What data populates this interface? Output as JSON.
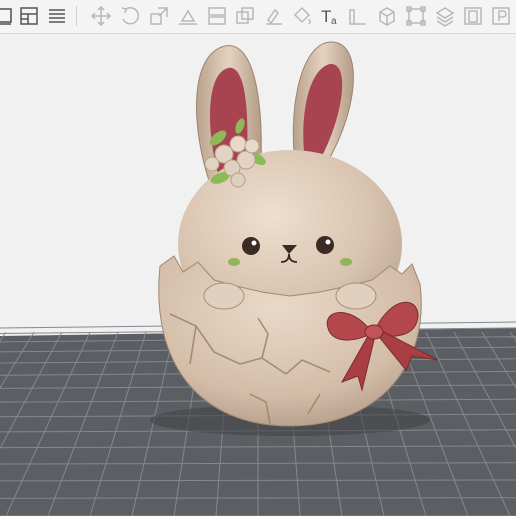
{
  "app": {
    "toolbar": {
      "items": [
        {
          "id": "select",
          "icon": "select-box-icon"
        },
        {
          "id": "layout",
          "icon": "layout-panel-icon"
        },
        {
          "id": "list",
          "icon": "list-lines-icon"
        },
        {
          "id": "move",
          "icon": "move-arrows-icon"
        },
        {
          "id": "rotate",
          "icon": "rotate-icon"
        },
        {
          "id": "scale",
          "icon": "scale-icon"
        },
        {
          "id": "place-on-face",
          "icon": "place-on-face-icon"
        },
        {
          "id": "cut",
          "icon": "cut-icon"
        },
        {
          "id": "boolean",
          "icon": "boolean-icon"
        },
        {
          "id": "support-paint",
          "icon": "support-paint-icon"
        },
        {
          "id": "color-paint",
          "icon": "color-paint-icon"
        },
        {
          "id": "text",
          "icon": "text-icon",
          "label": "T",
          "sub": "a"
        },
        {
          "id": "measure",
          "icon": "measure-icon"
        },
        {
          "id": "assembly",
          "icon": "assembly-cube-icon"
        },
        {
          "id": "bounding",
          "icon": "bounding-box-icon"
        },
        {
          "id": "layers",
          "icon": "layers-icon"
        },
        {
          "id": "object",
          "icon": "object-icon",
          "label": "0"
        },
        {
          "id": "plate",
          "icon": "plate-icon",
          "label": "P"
        }
      ]
    },
    "viewport": {
      "background": "#f1f1f1",
      "bed_color": "#5b5e63",
      "grid_color": "#8a8d92",
      "model_color": "#d8c4b1",
      "ear_inner_color": "#a8444f",
      "bow_color": "#b3474c",
      "leaf_color": "#8eb95a"
    }
  }
}
